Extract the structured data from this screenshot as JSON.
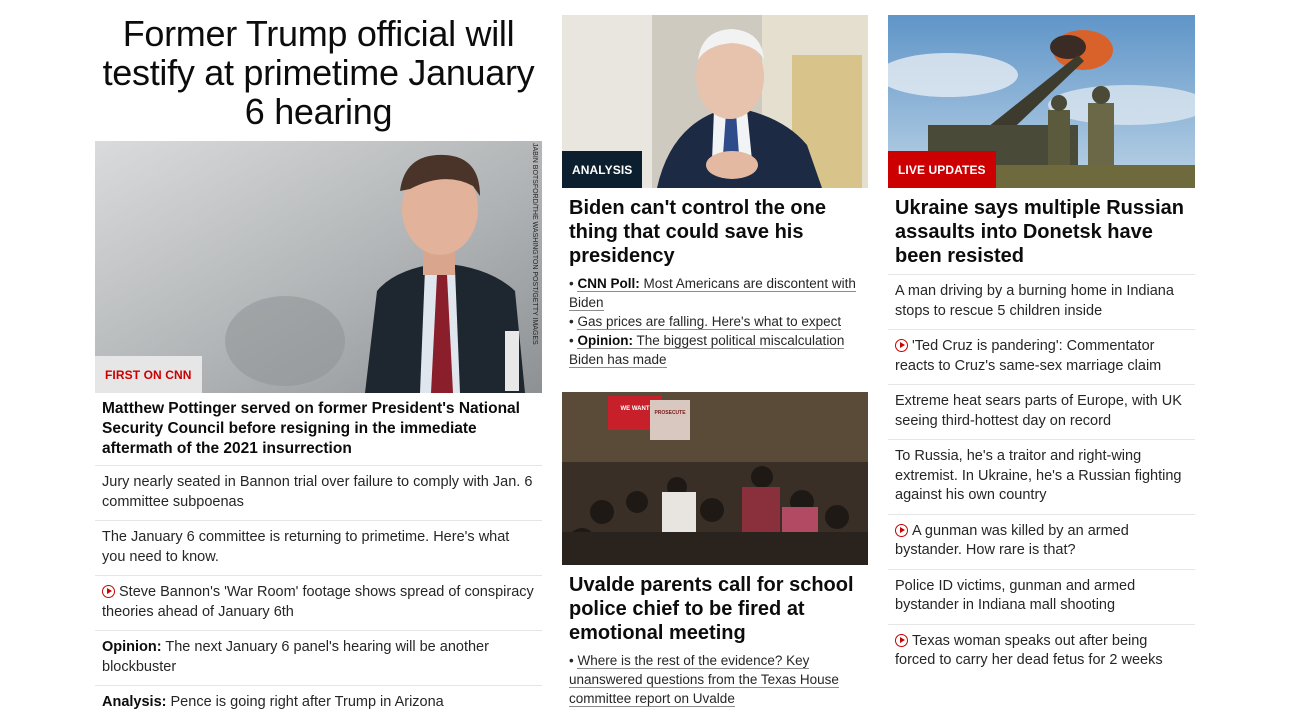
{
  "col1": {
    "headline": "Former Trump official will testify at primetime January 6 hearing",
    "image": {
      "badge": "FIRST ON CNN",
      "credit": "JABIN BOTSFORD/THE WASHINGTON POST/GETTY IMAGES"
    },
    "story_title": "Matthew Pottinger served on former President's National Security Council before resigning in the immediate aftermath of the 2021 insurrection",
    "items": [
      {
        "prefix": "",
        "text": "Jury nearly seated in Bannon trial over failure to comply with Jan. 6 committee subpoenas",
        "video": false
      },
      {
        "prefix": "",
        "text": "The January 6 committee is returning to primetime. Here's what you need to know.",
        "video": false
      },
      {
        "prefix": "",
        "text": "Steve Bannon's 'War Room' footage shows spread of conspiracy theories ahead of January 6th",
        "video": true
      },
      {
        "prefix": "Opinion:",
        "text": " The next January 6 panel's hearing will be another blockbuster",
        "video": false
      },
      {
        "prefix": "Analysis:",
        "text": " Pence is going right after Trump in Arizona",
        "video": false
      }
    ]
  },
  "col2": {
    "top": {
      "badge": "ANALYSIS",
      "title": "Biden can't control the one thing that could save his presidency",
      "bullets": [
        {
          "prefix": "CNN Poll:",
          "text": " Most Americans are discontent with Biden"
        },
        {
          "prefix": "",
          "text": "Gas prices are falling. Here's what to expect"
        },
        {
          "prefix": "Opinion:",
          "text": " The biggest political miscalculation Biden has made"
        }
      ]
    },
    "bottom": {
      "title": "Uvalde parents call for school police chief to be fired at emotional meeting",
      "sign1": "WE WANT ACCOUNTABILITY",
      "sign2": "PROSECUTE PETE ARREDONDO",
      "bullets": [
        {
          "prefix": "",
          "text": "Where is the rest of the evidence? Key unanswered questions from the Texas House committee report on Uvalde"
        }
      ]
    }
  },
  "col3": {
    "badge": "LIVE UPDATES",
    "title": "Ukraine says multiple Russian assaults into Donetsk have been resisted",
    "items": [
      {
        "text": "A man driving by a burning home in Indiana stops to rescue 5 children inside",
        "video": false
      },
      {
        "text": "'Ted Cruz is pandering': Commentator reacts to Cruz's same-sex marriage claim",
        "video": true
      },
      {
        "text": "Extreme heat sears parts of Europe, with UK seeing third-hottest day on record",
        "video": false
      },
      {
        "text": "To Russia, he's a traitor and right-wing extremist. In Ukraine, he's a Russian fighting against his own country",
        "video": false
      },
      {
        "text": "A gunman was killed by an armed bystander. How rare is that?",
        "video": true
      },
      {
        "text": "Police ID victims, gunman and armed bystander in Indiana mall shooting",
        "video": false
      },
      {
        "text": "Texas woman speaks out after being forced to carry her dead fetus for 2 weeks",
        "video": true
      }
    ]
  }
}
